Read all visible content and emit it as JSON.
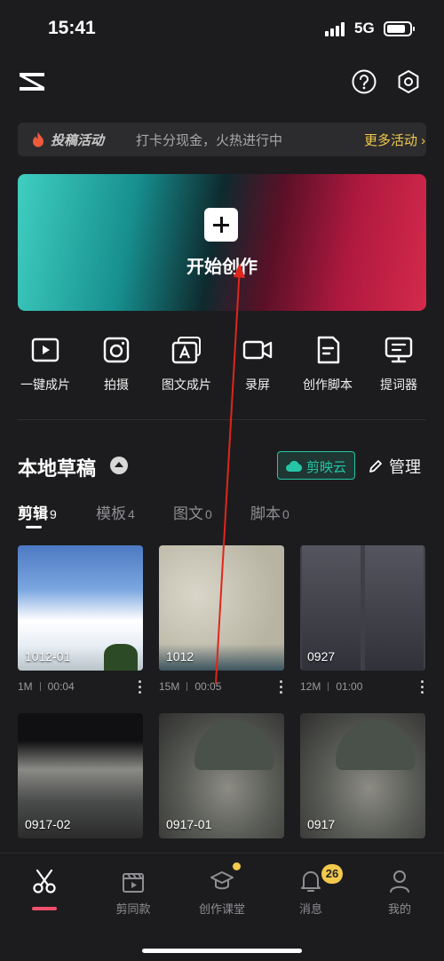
{
  "status_bar": {
    "time": "15:41",
    "network": "5G"
  },
  "header": {
    "logo_icon": "capcut-logo-icon",
    "help_icon": "help-icon",
    "settings_icon": "settings-hexagon-icon"
  },
  "promo": {
    "tag": "投稿活动",
    "text": "打卡分现金，火热进行中",
    "more": "更多活动 ›"
  },
  "create": {
    "label": "开始创作"
  },
  "tools": [
    {
      "label": "一键成片",
      "icon": "play-square-icon"
    },
    {
      "label": "拍摄",
      "icon": "camera-icon"
    },
    {
      "label": "图文成片",
      "icon": "text-to-video-icon"
    },
    {
      "label": "录屏",
      "icon": "video-record-icon"
    },
    {
      "label": "创作脚本",
      "icon": "script-icon"
    },
    {
      "label": "提词器",
      "icon": "teleprompter-icon"
    }
  ],
  "drafts": {
    "title": "本地草稿",
    "cloud_label": "剪映云",
    "manage_label": "管理",
    "tabs": [
      {
        "name": "剪辑",
        "count": "9",
        "active": true
      },
      {
        "name": "模板",
        "count": "4"
      },
      {
        "name": "图文",
        "count": "0"
      },
      {
        "name": "脚本",
        "count": "0"
      }
    ],
    "items": [
      {
        "label": "1012-01",
        "size": "1M",
        "duration": "00:04"
      },
      {
        "label": "1012",
        "size": "15M",
        "duration": "00:05"
      },
      {
        "label": "0927",
        "size": "12M",
        "duration": "01:00"
      },
      {
        "label": "0917-02",
        "size": "",
        "duration": ""
      },
      {
        "label": "0917-01",
        "size": "",
        "duration": ""
      },
      {
        "label": "0917",
        "size": "",
        "duration": ""
      }
    ]
  },
  "bottom_nav": [
    {
      "label": "",
      "icon": "scissors-icon",
      "active": true
    },
    {
      "label": "剪同款",
      "icon": "template-clapper-icon"
    },
    {
      "label": "创作课堂",
      "icon": "graduation-cap-icon"
    },
    {
      "label": "消息",
      "icon": "bell-icon",
      "badge": "26"
    },
    {
      "label": "我的",
      "icon": "profile-icon"
    }
  ],
  "colors": {
    "accent_teal": "#25c6a6",
    "accent_yellow": "#f2c94c",
    "active_tab": "#f0506e",
    "annotation_arrow": "#e0261c"
  }
}
